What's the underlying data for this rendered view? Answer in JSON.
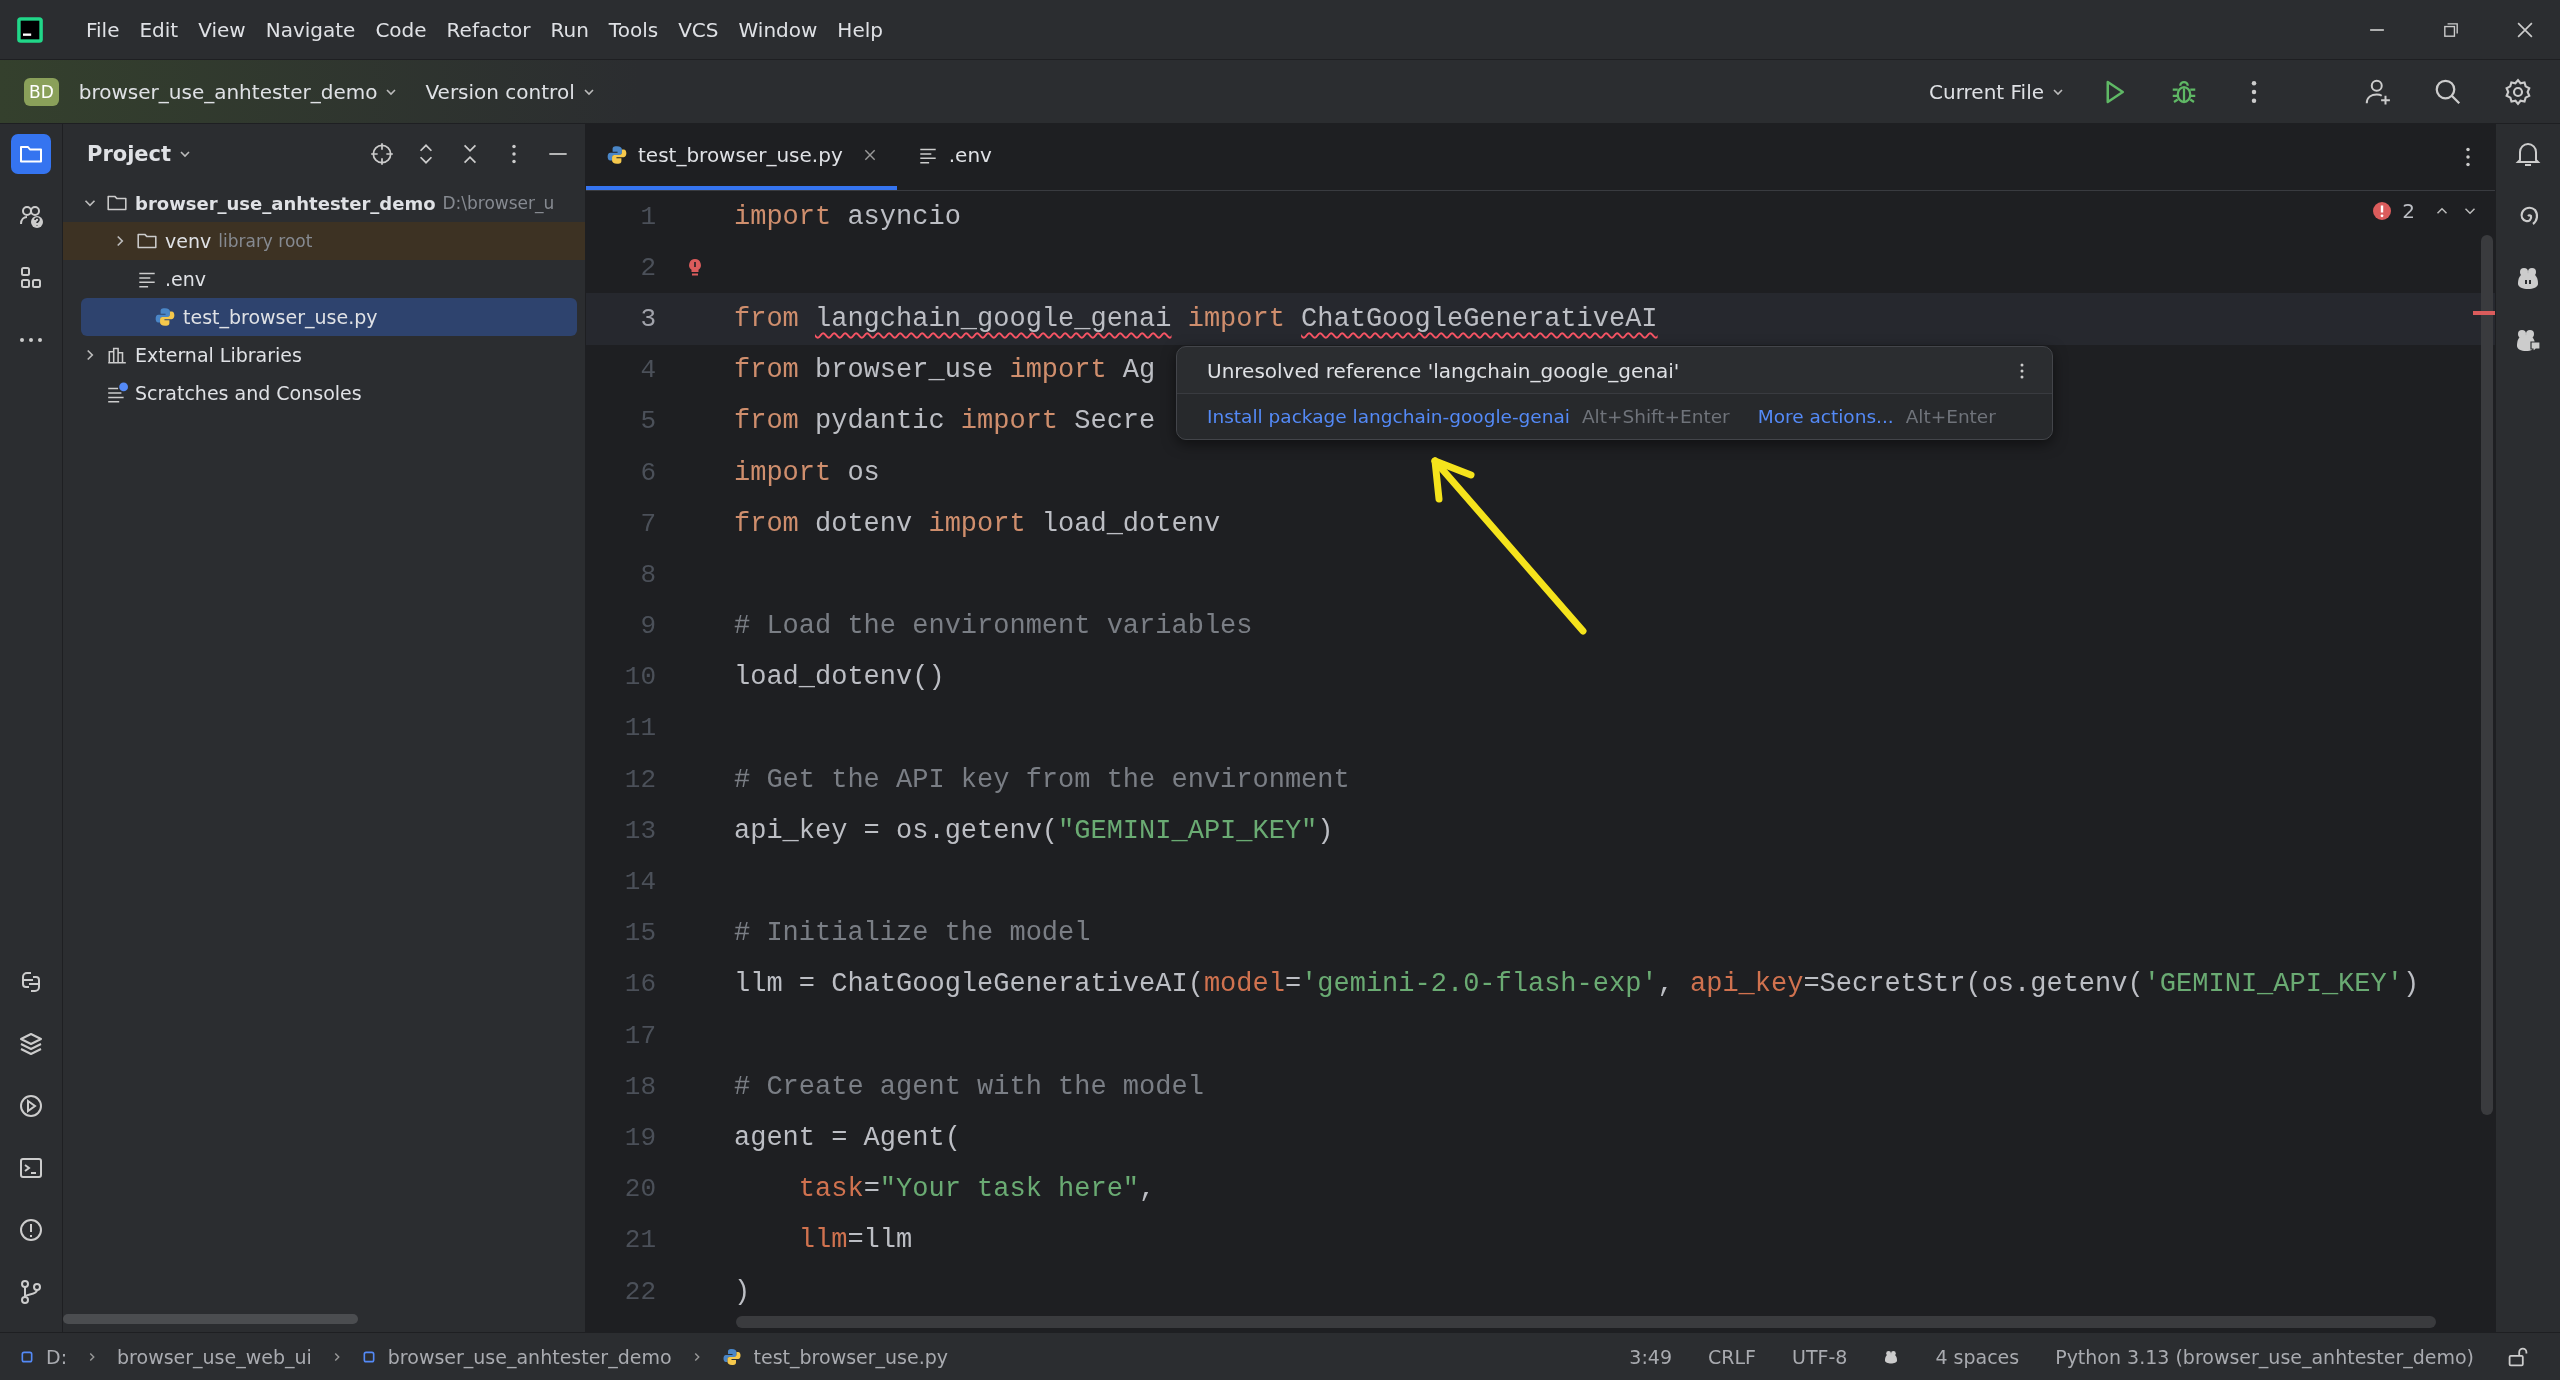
{
  "menu": [
    "File",
    "Edit",
    "View",
    "Navigate",
    "Code",
    "Refactor",
    "Run",
    "Tools",
    "VCS",
    "Window",
    "Help"
  ],
  "toolbar": {
    "project_badge": "BD",
    "project": "browser_use_anhtester_demo",
    "vcs": "Version control",
    "run_config": "Current File"
  },
  "project_panel": {
    "title": "Project",
    "tree": [
      {
        "label": "browser_use_anhtester_demo",
        "kind": "folder",
        "bold": true,
        "path": "D:\\browser_u",
        "expanded": true,
        "selected": false,
        "highlighted": false,
        "children": [
          {
            "label": "venv",
            "kind": "folder",
            "hint": "library root",
            "expanded": false,
            "selected": false,
            "highlighted": true
          },
          {
            "label": ".env",
            "kind": "text",
            "selected": false,
            "highlighted": false
          },
          {
            "label": "test_browser_use.py",
            "kind": "python",
            "selected": true,
            "highlighted": false
          }
        ]
      },
      {
        "label": "External Libraries",
        "kind": "libraries",
        "expanded": false,
        "selected": false,
        "highlighted": false
      },
      {
        "label": "Scratches and Consoles",
        "kind": "scratches",
        "selected": false,
        "highlighted": false
      }
    ]
  },
  "tabs": [
    {
      "label": "test_browser_use.py",
      "kind": "python",
      "selected": true,
      "closable": true
    },
    {
      "label": ".env",
      "kind": "text",
      "selected": false,
      "closable": false
    }
  ],
  "problems": {
    "count": "2"
  },
  "lines": [
    {
      "number": "1",
      "current": false,
      "bulb": false,
      "tokens": [
        {
          "kind": "keyword",
          "text": "import"
        },
        {
          "kind": "plain",
          "text": " asyncio"
        }
      ]
    },
    {
      "number": "2",
      "current": false,
      "bulb": true
    },
    {
      "number": "3",
      "current": true,
      "bulb": false,
      "tokens": [
        {
          "kind": "keyword",
          "text": "from "
        },
        {
          "kind": "unresolved",
          "text": "langchain_google_genai"
        },
        {
          "kind": "keyword",
          "text": " import "
        },
        {
          "kind": "unresolved",
          "text": "ChatGoogleGenerativeAI"
        }
      ]
    },
    {
      "number": "4",
      "current": false,
      "bulb": false,
      "tokens": [
        {
          "kind": "keyword",
          "text": "from"
        },
        {
          "kind": "plain",
          "text": " browser_use "
        },
        {
          "kind": "keyword",
          "text": "import"
        },
        {
          "kind": "plain",
          "text": " Ag"
        }
      ]
    },
    {
      "number": "5",
      "current": false,
      "bulb": false,
      "tokens": [
        {
          "kind": "keyword",
          "text": "from"
        },
        {
          "kind": "plain",
          "text": " pydantic "
        },
        {
          "kind": "keyword",
          "text": "import"
        },
        {
          "kind": "plain",
          "text": " Secre"
        }
      ]
    },
    {
      "number": "6",
      "current": false,
      "bulb": false,
      "tokens": [
        {
          "kind": "keyword",
          "text": "import"
        },
        {
          "kind": "plain",
          "text": " os"
        }
      ]
    },
    {
      "number": "7",
      "current": false,
      "bulb": false,
      "tokens": [
        {
          "kind": "keyword",
          "text": "from"
        },
        {
          "kind": "plain",
          "text": " dotenv "
        },
        {
          "kind": "keyword",
          "text": "import"
        },
        {
          "kind": "plain",
          "text": " load_dotenv"
        }
      ]
    },
    {
      "number": "8",
      "current": false,
      "bulb": false
    },
    {
      "number": "9",
      "current": false,
      "bulb": false,
      "tokens": [
        {
          "kind": "comment",
          "text": "# Load the environment variables"
        }
      ]
    },
    {
      "number": "10",
      "current": false,
      "bulb": false,
      "tokens": [
        {
          "kind": "plain",
          "text": "load_dotenv()"
        }
      ]
    },
    {
      "number": "11",
      "current": false,
      "bulb": false
    },
    {
      "number": "12",
      "current": false,
      "bulb": false,
      "tokens": [
        {
          "kind": "comment",
          "text": "# Get the API key from the environment"
        }
      ]
    },
    {
      "number": "13",
      "current": false,
      "bulb": false,
      "tokens": [
        {
          "kind": "plain",
          "text": "api_key = os.getenv("
        },
        {
          "kind": "string",
          "text": "\"GEMINI_API_KEY\""
        },
        {
          "kind": "plain",
          "text": ")"
        }
      ]
    },
    {
      "number": "14",
      "current": false,
      "bulb": false
    },
    {
      "number": "15",
      "current": false,
      "bulb": false,
      "tokens": [
        {
          "kind": "comment",
          "text": "# Initialize the model"
        }
      ]
    },
    {
      "number": "16",
      "current": false,
      "bulb": false,
      "tokens": [
        {
          "kind": "plain",
          "text": "llm = ChatGoogleGenerativeAI("
        },
        {
          "kind": "param",
          "text": "model"
        },
        {
          "kind": "plain",
          "text": "="
        },
        {
          "kind": "string",
          "text": "'gemini-2.0-flash-exp'"
        },
        {
          "kind": "plain",
          "text": ", "
        },
        {
          "kind": "param",
          "text": "api_key"
        },
        {
          "kind": "plain",
          "text": "=SecretStr(os.getenv("
        },
        {
          "kind": "string",
          "text": "'GEMINI_API_KEY'"
        },
        {
          "kind": "plain",
          "text": ")"
        }
      ]
    },
    {
      "number": "17",
      "current": false,
      "bulb": false
    },
    {
      "number": "18",
      "current": false,
      "bulb": false,
      "tokens": [
        {
          "kind": "comment",
          "text": "# Create agent with the model"
        }
      ]
    },
    {
      "number": "19",
      "current": false,
      "bulb": false,
      "tokens": [
        {
          "kind": "plain",
          "text": "agent = Agent("
        }
      ]
    },
    {
      "number": "20",
      "current": false,
      "bulb": false,
      "tokens": [
        {
          "kind": "param",
          "text": "    task"
        },
        {
          "kind": "plain",
          "text": "="
        },
        {
          "kind": "string",
          "text": "\"Your task here\""
        },
        {
          "kind": "plain",
          "text": ","
        }
      ]
    },
    {
      "number": "21",
      "current": false,
      "bulb": false,
      "tokens": [
        {
          "kind": "param",
          "text": "    llm"
        },
        {
          "kind": "plain",
          "text": "=llm"
        }
      ]
    },
    {
      "number": "22",
      "current": false,
      "bulb": false,
      "tokens": [
        {
          "kind": "plain",
          "text": ")"
        }
      ]
    }
  ],
  "popup": {
    "message": "Unresolved reference 'langchain_google_genai'",
    "action": "Install package langchain-google-genai",
    "action_shortcut": "Alt+Shift+Enter",
    "more": "More actions...",
    "more_shortcut": "Alt+Enter"
  },
  "status_bar": {
    "breadcrumbs": [
      {
        "label": "D:"
      },
      {
        "label": "browser_use_web_ui"
      },
      {
        "label": "browser_use_anhtester_demo"
      },
      {
        "label": "test_browser_use.py"
      }
    ],
    "position": "3:49",
    "line_ending": "CRLF",
    "encoding": "UTF-8",
    "indent": "4 spaces",
    "interpreter": "Python 3.13 (browser_use_anhtester_demo)"
  }
}
